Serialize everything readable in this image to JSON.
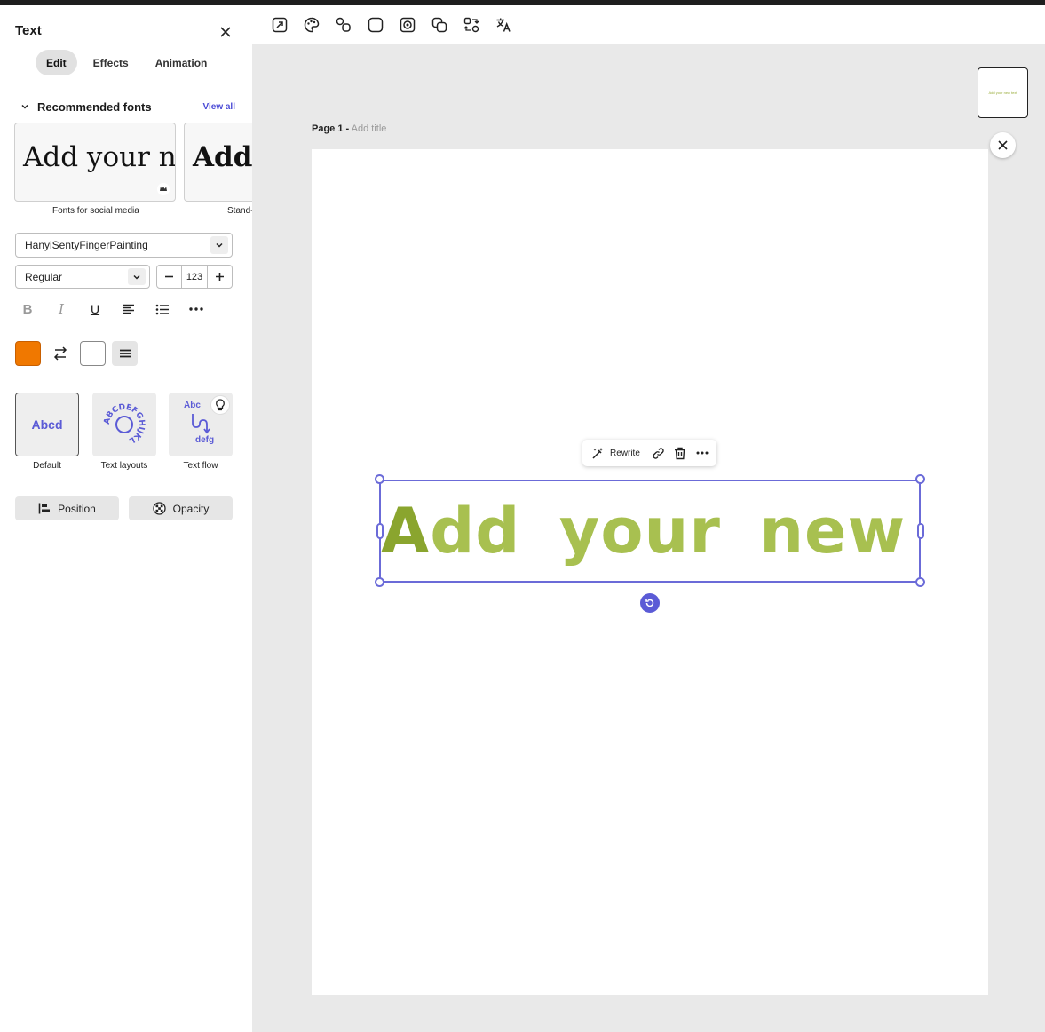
{
  "panel": {
    "title": "Text",
    "tabs": [
      {
        "label": "Edit",
        "active": true
      },
      {
        "label": "Effects",
        "active": false
      },
      {
        "label": "Animation",
        "active": false
      }
    ],
    "recommended": {
      "title": "Recommended fonts",
      "view_all": "View all",
      "cards": [
        {
          "sample": "Add your new",
          "label": "Fonts for social media",
          "premium": true
        },
        {
          "sample": "Add y",
          "label": "Stand-"
        }
      ]
    },
    "font_family": "HanyiSentyFingerPainting",
    "font_weight": "Regular",
    "font_size": "123",
    "format_buttons": [
      "bold",
      "italic",
      "underline",
      "align-left",
      "bulleted-list",
      "more"
    ],
    "colors": {
      "fill": "#f07800",
      "stroke": "#ffffff"
    },
    "layouts": [
      {
        "label": "Default",
        "sample": "Abcd"
      },
      {
        "label": "Text layouts",
        "sample": "ABCDEFGHIJKL"
      },
      {
        "label": "Text flow",
        "sample_top": "Abc",
        "sample_bottom": "defg"
      }
    ],
    "position_label": "Position",
    "opacity_label": "Opacity"
  },
  "toolbar": {
    "tools": [
      "resize-icon",
      "palette-icon",
      "shapes-icon",
      "rounded-square-icon",
      "image-frame-icon",
      "layers-icon",
      "swap-icon",
      "translate-icon"
    ]
  },
  "canvas": {
    "page_label": "Page 1 -",
    "add_title": "Add title",
    "text": "Add your new text",
    "text_first": "A",
    "text_rest": "dd your new text",
    "text_color": "#a8c050",
    "thumb_text": "Add your new text"
  },
  "context_menu": {
    "rewrite_label": "Rewrite"
  },
  "accent": "#6b6bd8"
}
